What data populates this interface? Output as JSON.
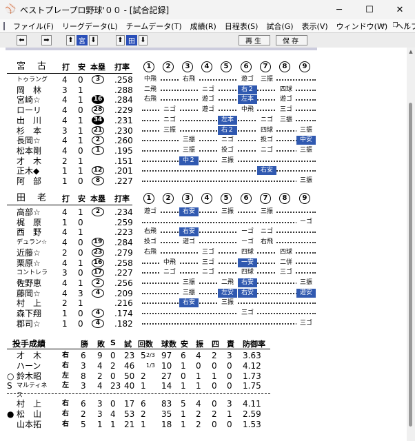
{
  "window": {
    "title": "ベストプレープロ野球'００ - [試合記録]",
    "minimize": "─",
    "maximize": "☐",
    "close": "✕"
  },
  "menu": [
    "ファイル(F)",
    "リーグデータ(L)",
    "チームデータ(T)",
    "成績(R)",
    "日程表(S)",
    "試合(G)",
    "表示(V)",
    "ウィンドウ(W)",
    "ヘルプ(H)"
  ],
  "toolbar": {
    "team_a": "宮",
    "team_b": "田",
    "play": "再生",
    "save": "保存"
  },
  "batting_cols": {
    "hit_runs": "打",
    "hits": "安",
    "hr": "本塁",
    "avg": "打率"
  },
  "innings": [
    "1",
    "2",
    "3",
    "4",
    "5",
    "6",
    "7",
    "8",
    "9"
  ],
  "teams": [
    {
      "name": "宮　古",
      "players": [
        {
          "name": "トゥラング",
          "ab": "4",
          "h": "0",
          "hr": "3",
          "hr_fill": false,
          "avg": ".258",
          "res": [
            [
              "中飛",
              ""
            ],
            [
              "右飛",
              ""
            ],
            [
              "遊ゴ",
              ""
            ],
            [
              "三振",
              ""
            ]
          ]
        },
        {
          "name": "岡　林",
          "ab": "3",
          "h": "1",
          "hr": "",
          "hr_fill": false,
          "avg": ".288",
          "res": [
            [
              "二飛",
              ""
            ],
            [
              "ニゴ",
              ""
            ],
            [
              "右２",
              "hit"
            ],
            [
              "四球",
              ""
            ]
          ]
        },
        {
          "name": "宮崎☆",
          "ab": "4",
          "h": "1",
          "hr": "16",
          "hr_fill": true,
          "avg": ".284",
          "res": [
            [
              "右飛",
              ""
            ],
            [
              "遊ゴ",
              ""
            ],
            [
              "左本",
              "hit"
            ],
            [
              "遊ゴ",
              ""
            ]
          ]
        },
        {
          "name": "ローリー",
          "ab": "4",
          "h": "0",
          "hr": "28",
          "hr_fill": false,
          "avg": ".229",
          "res": [
            [
              "ニゴ",
              ""
            ],
            [
              "遊ゴ",
              ""
            ],
            [
              "中飛",
              ""
            ],
            [
              "三ゴ",
              ""
            ]
          ]
        },
        {
          "name": "山　川",
          "ab": "4",
          "h": "1",
          "hr": "34",
          "hr_fill": true,
          "avg": ".231",
          "res": [
            [
              "ニゴ",
              ""
            ],
            [
              "左本",
              "hit"
            ],
            [
              "ニゴ",
              ""
            ],
            [
              "三振",
              ""
            ]
          ]
        },
        {
          "name": "杉　本",
          "ab": "3",
          "h": "1",
          "hr": "21",
          "hr_fill": false,
          "avg": ".230",
          "res": [
            [
              "三振",
              ""
            ],
            [
              "右２",
              "hit"
            ],
            [
              "四球",
              ""
            ],
            [
              "三振",
              ""
            ]
          ]
        },
        {
          "name": "長岡☆",
          "ab": "4",
          "h": "1",
          "hr": "2",
          "hr_fill": false,
          "avg": ".260",
          "res": [
            [
              "三振",
              ""
            ],
            [
              "ニゴ",
              ""
            ],
            [
              "投ゴ",
              ""
            ],
            [
              "中安",
              "hit"
            ]
          ]
        },
        {
          "name": "松本剛",
          "ab": "4",
          "h": "0",
          "hr": "1",
          "hr_fill": false,
          "avg": ".195",
          "res": [
            [
              "三振",
              ""
            ],
            [
              "投ゴ",
              ""
            ],
            [
              "ニゴ",
              ""
            ],
            [
              "三振",
              ""
            ]
          ]
        },
        {
          "name": "才　木",
          "ab": "2",
          "h": "1",
          "hr": "",
          "hr_fill": false,
          "avg": ".151",
          "res": [
            [
              "中２",
              "hit"
            ],
            [
              "三振",
              ""
            ]
          ]
        },
        {
          "name": "正木◆",
          "ab": "1",
          "h": "1",
          "hr": "12",
          "hr_fill": false,
          "avg": ".201",
          "res": [
            [
              "右安",
              "hit"
            ]
          ]
        },
        {
          "name": "阿　部",
          "ab": "1",
          "h": "0",
          "hr": "8",
          "hr_fill": false,
          "avg": ".227",
          "res": [
            [
              "三振",
              ""
            ]
          ]
        }
      ]
    },
    {
      "name": "田　老",
      "players": [
        {
          "name": "高部☆",
          "ab": "4",
          "h": "1",
          "hr": "2",
          "hr_fill": false,
          "avg": ".234",
          "res": [
            [
              "遊ゴ",
              ""
            ],
            [
              "右安",
              "hit"
            ],
            [
              "三振",
              ""
            ],
            [
              "三振",
              ""
            ]
          ]
        },
        {
          "name": "梶　原",
          "ab": "1",
          "h": "0",
          "hr": "",
          "hr_fill": false,
          "avg": ".259",
          "res": [
            [
              "ーゴ",
              ""
            ]
          ]
        },
        {
          "name": "西　野",
          "ab": "4",
          "h": "1",
          "hr": "",
          "hr_fill": false,
          "avg": ".223",
          "res": [
            [
              "右飛",
              ""
            ],
            [
              "右安",
              "hit"
            ],
            [
              "ーゴ",
              ""
            ],
            [
              "ニゴ",
              ""
            ]
          ]
        },
        {
          "name": "デュラン☆",
          "ab": "4",
          "h": "0",
          "hr": "19",
          "hr_fill": false,
          "avg": ".284",
          "res": [
            [
              "投ゴ",
              ""
            ],
            [
              "遊ゴ",
              ""
            ],
            [
              "ーゴ",
              ""
            ],
            [
              "右飛",
              ""
            ]
          ]
        },
        {
          "name": "近藤☆",
          "ab": "2",
          "h": "0",
          "hr": "23",
          "hr_fill": false,
          "avg": ".279",
          "res": [
            [
              "右飛",
              ""
            ],
            [
              "三ゴ",
              ""
            ],
            [
              "四球",
              ""
            ],
            [
              "四球",
              ""
            ]
          ]
        },
        {
          "name": "栗原☆",
          "ab": "4",
          "h": "1",
          "hr": "16",
          "hr_fill": false,
          "avg": ".258",
          "res": [
            [
              "中飛",
              ""
            ],
            [
              "三ゴ",
              ""
            ],
            [
              "一安",
              "hit"
            ],
            [
              "二併",
              ""
            ]
          ]
        },
        {
          "name": "コントレラス",
          "ab": "3",
          "h": "0",
          "hr": "17",
          "hr_fill": false,
          "avg": ".227",
          "res": [
            [
              "ニゴ",
              ""
            ],
            [
              "ニゴ",
              ""
            ],
            [
              "四球",
              ""
            ],
            [
              "三ゴ",
              ""
            ]
          ]
        },
        {
          "name": "佐野恵",
          "ab": "4",
          "h": "1",
          "hr": "2",
          "hr_fill": false,
          "avg": ".256",
          "res": [
            [
              "三振",
              ""
            ],
            [
              "二飛",
              ""
            ],
            [
              "右安",
              "hit"
            ],
            [
              "三振",
              ""
            ]
          ]
        },
        {
          "name": "藤岡☆",
          "ab": "4",
          "h": "3",
          "hr": "4",
          "hr_fill": false,
          "avg": ".209",
          "res": [
            [
              "三振",
              ""
            ],
            [
              "左安",
              "hit"
            ],
            [
              "右安",
              "hit"
            ],
            [
              "遊安",
              "hit"
            ]
          ]
        },
        {
          "name": "村　上",
          "ab": "2",
          "h": "1",
          "hr": "",
          "hr_fill": false,
          "avg": ".216",
          "res": [
            [
              "右安",
              "hit"
            ],
            [
              "三振",
              ""
            ]
          ]
        },
        {
          "name": "森下翔",
          "ab": "1",
          "h": "0",
          "hr": "4",
          "hr_fill": false,
          "avg": ".174",
          "res": [
            [
              "三ゴ",
              ""
            ]
          ]
        },
        {
          "name": "郡司☆",
          "ab": "1",
          "h": "0",
          "hr": "4",
          "hr_fill": false,
          "avg": ".182",
          "res": [
            [
              "三ゴ",
              ""
            ]
          ]
        }
      ]
    }
  ],
  "pitching": {
    "title": "投手成績",
    "cols": [
      "勝",
      "敗",
      "S",
      "試",
      "回数",
      "球数",
      "安",
      "振",
      "四",
      "責",
      "防御率"
    ],
    "groups": [
      [
        {
          "mark": "",
          "name": "才　木",
          "hand": "右",
          "w": "6",
          "l": "9",
          "s": "0",
          "g": "23",
          "ip": "5",
          "ipf": "2/3",
          "np": "97",
          "h": "6",
          "k": "4",
          "bb": "2",
          "er": "3",
          "era": "3.63"
        },
        {
          "mark": "",
          "name": "ハーン",
          "hand": "右",
          "w": "3",
          "l": "4",
          "s": "2",
          "g": "46",
          "ip": "",
          "ipf": "1/3",
          "np": "10",
          "h": "1",
          "k": "0",
          "bb": "0",
          "er": "0",
          "era": "4.12"
        },
        {
          "mark": "○",
          "name": "鈴木昭",
          "hand": "左",
          "w": "8",
          "l": "2",
          "s": "0",
          "g": "50",
          "ip": "2",
          "ipf": "",
          "np": "27",
          "h": "0",
          "k": "1",
          "bb": "1",
          "er": "0",
          "era": "1.73"
        },
        {
          "mark": "S",
          "name": "マルティネス",
          "hand": "左",
          "w": "3",
          "l": "4",
          "s": "23",
          "g": "40",
          "ip": "1",
          "ipf": "",
          "np": "14",
          "h": "1",
          "k": "1",
          "bb": "0",
          "er": "0",
          "era": "1.75"
        }
      ],
      [
        {
          "mark": "",
          "name": "村　上",
          "hand": "右",
          "w": "6",
          "l": "3",
          "s": "0",
          "g": "17",
          "ip": "6",
          "ipf": "",
          "np": "83",
          "h": "5",
          "k": "4",
          "bb": "0",
          "er": "3",
          "era": "4.11"
        },
        {
          "mark": "●",
          "name": "松　山",
          "hand": "右",
          "w": "2",
          "l": "3",
          "s": "4",
          "g": "53",
          "ip": "2",
          "ipf": "",
          "np": "35",
          "h": "1",
          "k": "2",
          "bb": "2",
          "er": "1",
          "era": "2.59"
        },
        {
          "mark": "",
          "name": "山本拓",
          "hand": "右",
          "w": "5",
          "l": "1",
          "s": "1",
          "g": "21",
          "ip": "1",
          "ipf": "",
          "np": "18",
          "h": "1",
          "k": "2",
          "bb": "0",
          "er": "0",
          "era": "1.53"
        }
      ]
    ]
  }
}
